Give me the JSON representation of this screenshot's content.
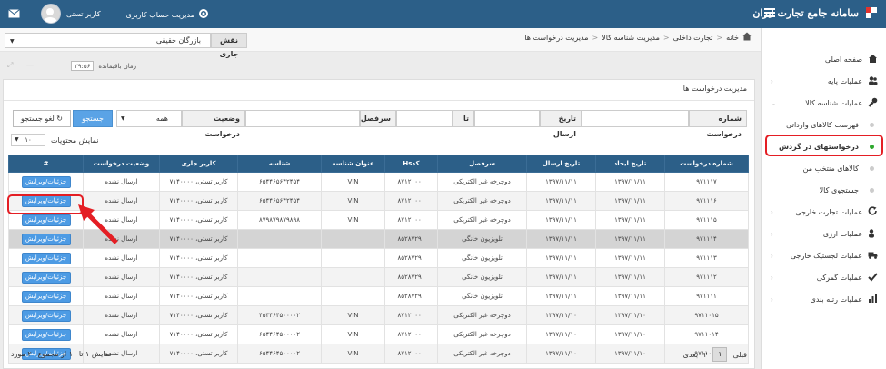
{
  "header": {
    "site_title": "سامانه جامع تجارت ایران",
    "account_menu": "مدیریت حساب کاربری",
    "user_name": "کاربر تستی"
  },
  "role": {
    "tab_label": "نقش جاری",
    "selected_role": "بازرگان حقیقی"
  },
  "breadcrumb": [
    "خانه",
    "تجارت داخلی",
    "مدیریت شناسه کالا",
    "مدیریت درخواست ها"
  ],
  "timer": {
    "label": "زمان باقیمانده",
    "value": "۲۹:۵۶"
  },
  "panel_title": "مدیریت درخواست ها",
  "filters": {
    "request_number": "شماره درخواست",
    "send_date": "تاریخ ارسال",
    "to": "تا",
    "heading": "سرفصل",
    "request_status": "وضعیت درخواست",
    "status_value": "همه",
    "search": "جستجو",
    "cancel_search": "لغو جستجو",
    "show_items": "نمایش محتویات",
    "page_size": "۱۰"
  },
  "sidebar": {
    "items": [
      {
        "label": "صفحه اصلی",
        "icon": "home-icon"
      },
      {
        "label": "عملیات پایه",
        "icon": "users-icon"
      },
      {
        "label": "عملیات شناسه کالا",
        "icon": "wrench-icon"
      }
    ],
    "subitems": [
      {
        "label": "فهرست کالاهای وارداتی",
        "active": false
      },
      {
        "label": "درخواستهای در گردش",
        "active": true
      },
      {
        "label": "کالاهای منتخب من",
        "active": false
      },
      {
        "label": "جستجوی کالا",
        "active": false
      }
    ],
    "items2": [
      {
        "label": "عملیات تجارت خارجی",
        "icon": "refresh-icon"
      },
      {
        "label": "عملیات ارزی",
        "icon": "money-icon"
      },
      {
        "label": "عملیات لجستیک خارجی",
        "icon": "truck-icon"
      },
      {
        "label": "عملیات گمرکی",
        "icon": "check-icon"
      },
      {
        "label": "عملیات رتبه بندی",
        "icon": "chart-icon"
      }
    ]
  },
  "table": {
    "columns": [
      "شماره درخواست",
      "تاریخ ایجاد",
      "تاریخ ارسال",
      "سرفصل",
      "کدHs",
      "عنوان شناسه",
      "شناسه",
      "کاربر جاری",
      "وضعیت درخواست",
      "#"
    ],
    "rows": [
      [
        "۹۷۱۱۱۷",
        "۱۳۹۷/۱۱/۱۱",
        "۱۳۹۷/۱۱/۱۱",
        "دوچرخه غیر الکتریکی",
        "۸۷۱۲۰۰۰۰",
        "VIN",
        "۶۵۴۴۶۵۶۴۲۴۵۴",
        "کاربر تستی، ۷۱۴۰۰۰۰",
        "ارسال نشده",
        "جزئیات/ویرایش"
      ],
      [
        "۹۷۱۱۱۶",
        "۱۳۹۷/۱۱/۱۱",
        "۱۳۹۷/۱۱/۱۱",
        "دوچرخه غیر الکتریکی",
        "۸۷۱۲۰۰۰۰",
        "VIN",
        "۶۵۴۴۶۵۶۴۲۴۵۴",
        "کاربر تستی، ۷۱۴۰۰۰۰",
        "ارسال نشده",
        "جزئیات/ویرایش"
      ],
      [
        "۹۷۱۱۱۵",
        "۱۳۹۷/۱۱/۱۱",
        "۱۳۹۷/۱۱/۱۱",
        "دوچرخه غیر الکتریکی",
        "۸۷۱۲۰۰۰۰",
        "VIN",
        "۸۷۹۸۷۹۸۷۹۸۹۸",
        "کاربر تستی، ۷۱۴۰۰۰۰",
        "ارسال نشده",
        "جزئیات/ویرایش"
      ],
      [
        "۹۷۱۱۱۴",
        "۱۳۹۷/۱۱/۱۱",
        "۱۳۹۷/۱۱/۱۱",
        "تلویزیون خانگی",
        "۸۵۲۸۷۲۹۰",
        "",
        "",
        "کاربر تستی، ۷۱۴۰۰۰۰",
        "ارسال نشده",
        "جزئیات/ویرایش"
      ],
      [
        "۹۷۱۱۱۳",
        "۱۳۹۷/۱۱/۱۱",
        "۱۳۹۷/۱۱/۱۱",
        "تلویزیون خانگی",
        "۸۵۲۸۷۲۹۰",
        "",
        "",
        "کاربر تستی، ۷۱۴۰۰۰۰",
        "ارسال نشده",
        "جزئیات/ویرایش"
      ],
      [
        "۹۷۱۱۱۲",
        "۱۳۹۷/۱۱/۱۱",
        "۱۳۹۷/۱۱/۱۱",
        "تلویزیون خانگی",
        "۸۵۲۸۷۲۹۰",
        "",
        "",
        "کاربر تستی، ۷۱۴۰۰۰۰",
        "ارسال نشده",
        "جزئیات/ویرایش"
      ],
      [
        "۹۷۱۱۱۱",
        "۱۳۹۷/۱۱/۱۱",
        "۱۳۹۷/۱۱/۱۱",
        "تلویزیون خانگی",
        "۸۵۲۸۷۲۹۰",
        "",
        "",
        "کاربر تستی، ۷۱۴۰۰۰۰",
        "ارسال نشده",
        "جزئیات/ویرایش"
      ],
      [
        "۹۷۱۱۰۱۵",
        "۱۳۹۷/۱۱/۱۰",
        "۱۳۹۷/۱۱/۱۰",
        "دوچرخه غیر الکتریکی",
        "۸۷۱۲۰۰۰۰",
        "VIN",
        "۴۵۴۴۶۴۵۰۰۰۰۲",
        "کاربر تستی، ۷۱۴۰۰۰۰",
        "ارسال نشده",
        "جزئیات/ویرایش"
      ],
      [
        "۹۷۱۱۰۱۴",
        "۱۳۹۷/۱۱/۱۰",
        "۱۳۹۷/۱۱/۱۰",
        "دوچرخه غیر الکتریکی",
        "۸۷۱۲۰۰۰۰",
        "VIN",
        "۶۵۴۴۶۴۵۰۰۰۰۲",
        "کاربر تستی، ۷۱۴۰۰۰۰",
        "ارسال نشده",
        "جزئیات/ویرایش"
      ],
      [
        "۹۷۱۱۰۱۳",
        "۱۳۹۷/۱۱/۱۰",
        "۱۳۹۷/۱۱/۱۰",
        "دوچرخه غیر الکتریکی",
        "۸۷۱۲۰۰۰۰",
        "VIN",
        "۶۵۴۴۶۴۵۰۰۰۰۲",
        "کاربر تستی، ۷۱۴۰۰۰۰",
        "ارسال نشده",
        "جزئیات/ویرایش"
      ]
    ]
  },
  "footer": {
    "summary": "نمایش ۱ تا ۱۰ از مجموع ۲۰ مورد",
    "prev": "قبلی",
    "next": "بعدی",
    "page1": "۱",
    "page2": "۲"
  },
  "colors": {
    "header": "#2c5f88",
    "button": "#4d9be4",
    "highlight": "#e41e24",
    "active_dot": "#2ea82e"
  }
}
